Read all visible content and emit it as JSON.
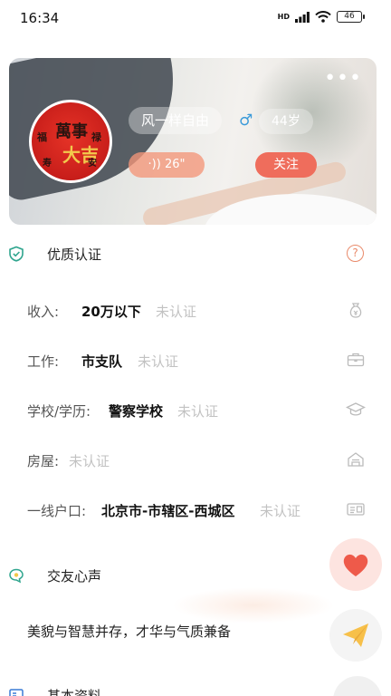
{
  "status_bar": {
    "time": "16:34",
    "network": "HD",
    "battery": "46"
  },
  "profile": {
    "name": "风一样自由",
    "gender_symbol": "♂",
    "age": "44岁",
    "voice_duration": "26\"",
    "voice_icon": "·))",
    "follow_label": "关注",
    "more_label": "•••",
    "avatar_glyphs": [
      "萬事",
      "大吉",
      "福",
      "禄",
      "寿",
      "安"
    ]
  },
  "verification": {
    "title": "优质认证",
    "help_label": "?",
    "rows": [
      {
        "label": "收入:",
        "value": "20万以下",
        "status": "未认证",
        "icon": "money-bag-icon"
      },
      {
        "label": "工作:",
        "value": "市支队",
        "status": "未认证",
        "icon": "briefcase-icon"
      },
      {
        "label": "学校/学历:",
        "value": "警察学校",
        "status": "未认证",
        "icon": "graduation-cap-icon"
      },
      {
        "label": "房屋:",
        "value": "",
        "status": "未认证",
        "icon": "house-icon"
      },
      {
        "label": "一线户口:",
        "value": "北京市-市辖区-西城区",
        "status": "未认证",
        "icon": "id-card-icon"
      }
    ]
  },
  "dating_voice": {
    "title": "交友心声",
    "text": "美貌与智慧并存，才华与气质兼备"
  },
  "basic_info": {
    "title": "基本资料"
  },
  "colors": {
    "accent": "#ef6d5c",
    "gender": "#3a9ad9",
    "unverified": "#c2c2c2",
    "heart": "#ee5a4a",
    "send": "#f7c04a"
  }
}
